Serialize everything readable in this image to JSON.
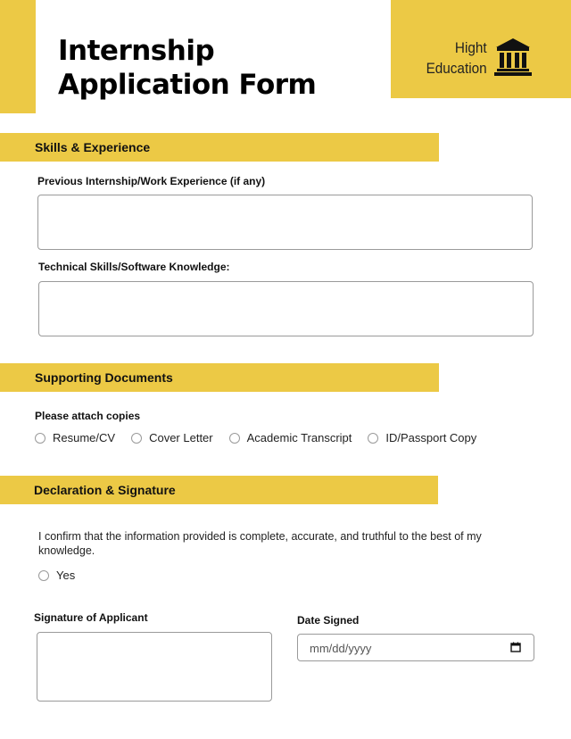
{
  "header": {
    "title_line1": "Internship",
    "title_line2": "Application Form",
    "brand_line1": "Hight",
    "brand_line2": "Education",
    "brand_icon": "institution-building-icon",
    "accent_color": "#ECC945"
  },
  "sections": {
    "skills": {
      "title": "Skills & Experience",
      "previous_experience_label": "Previous Internship/Work Experience (if any)",
      "previous_experience_value": "",
      "technical_skills_label": "Technical Skills/Software Knowledge:",
      "technical_skills_value": ""
    },
    "documents": {
      "title": "Supporting Documents",
      "attach_label": "Please attach copies",
      "options": [
        {
          "label": "Resume/CV",
          "checked": false
        },
        {
          "label": "Cover Letter",
          "checked": false
        },
        {
          "label": "Academic Transcript",
          "checked": false
        },
        {
          "label": "ID/Passport Copy",
          "checked": false
        }
      ]
    },
    "declaration": {
      "title": "Declaration & Signature",
      "statement": "I confirm that the information provided is complete, accurate, and truthful to the best of my knowledge.",
      "confirm_option": {
        "label": "Yes",
        "checked": false
      },
      "signature_label": "Signature of Applicant",
      "signature_value": "",
      "date_label": "Date Signed",
      "date_placeholder": "mm/dd/yyyy",
      "date_icon": "calendar-icon"
    }
  }
}
